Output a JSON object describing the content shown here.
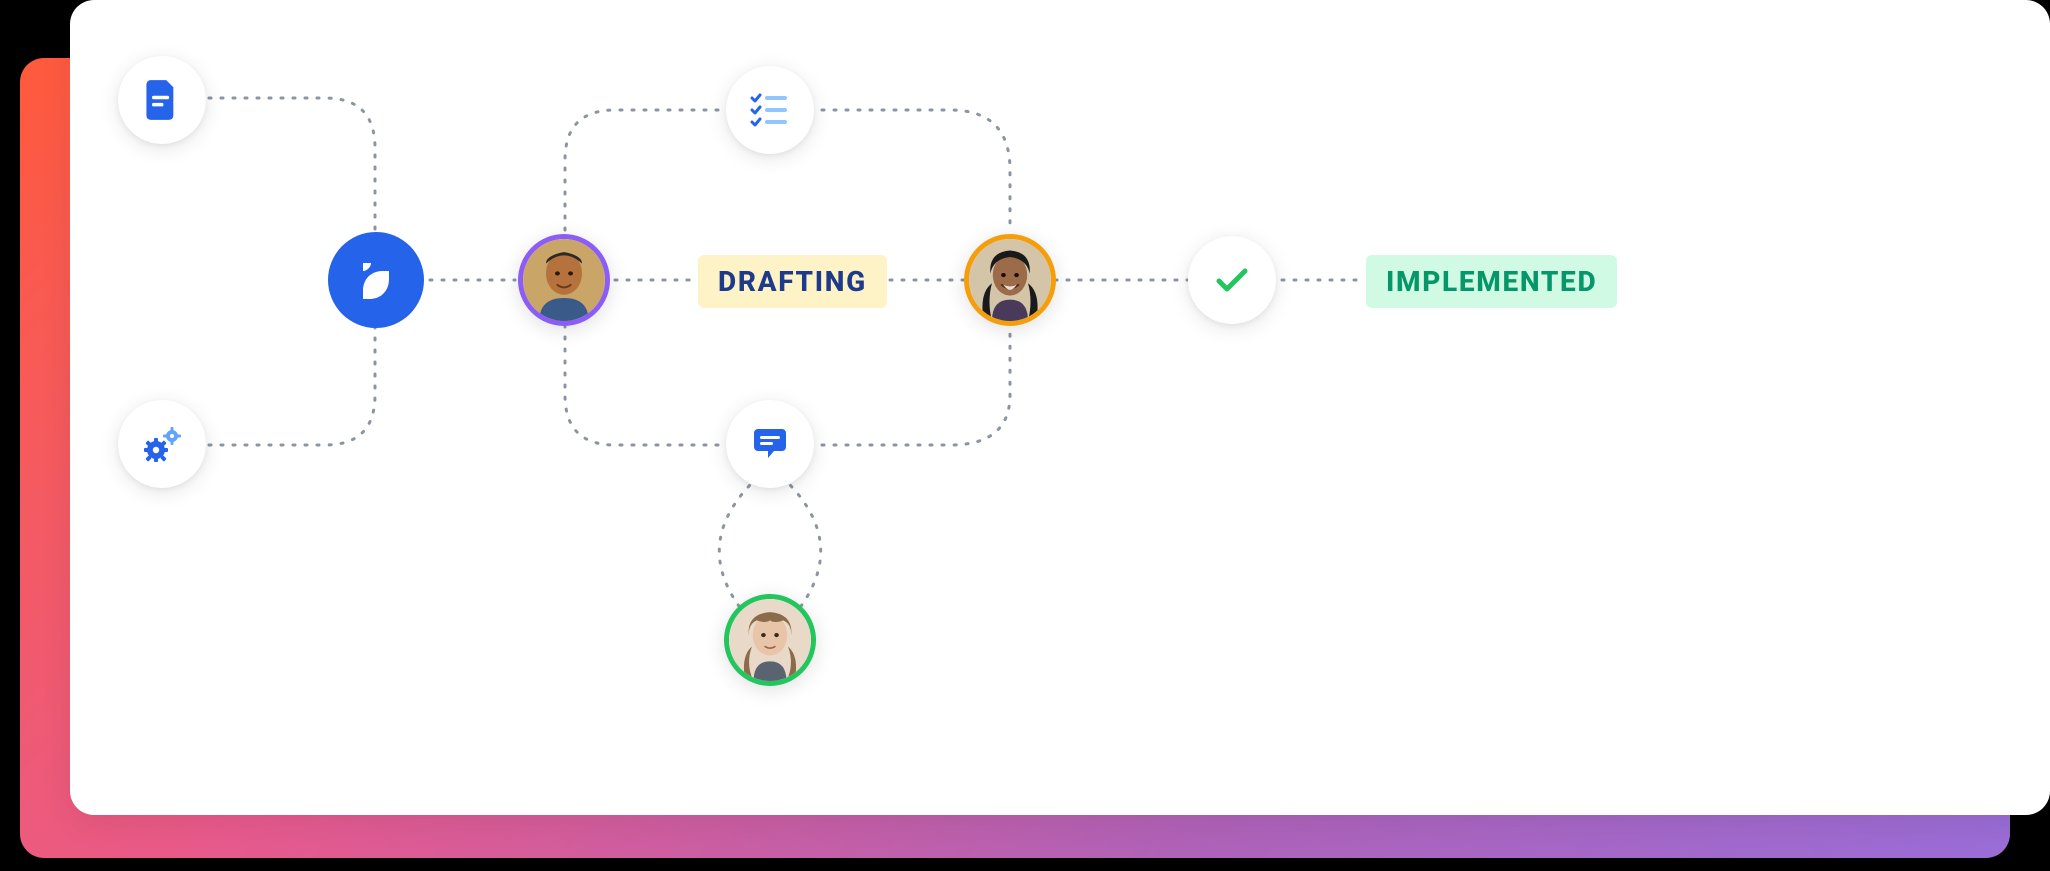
{
  "status": {
    "drafting_label": "DRAFTING",
    "implemented_label": "IMPLEMENTED"
  },
  "nodes": {
    "document": "document-icon",
    "settings": "gears-icon",
    "brand": "brand-logo-icon",
    "checklist": "checklist-icon",
    "comment": "comment-icon",
    "checkmark": "checkmark-icon",
    "avatar_1": "user-avatar-1",
    "avatar_2": "user-avatar-2",
    "avatar_3": "user-avatar-3"
  },
  "colors": {
    "blue": "#2563eb",
    "green": "#22c55e",
    "amber": "#f59e0b",
    "purple": "#8b5cf6",
    "draft_bg": "#fef3c7",
    "impl_bg": "#d1fae5"
  }
}
